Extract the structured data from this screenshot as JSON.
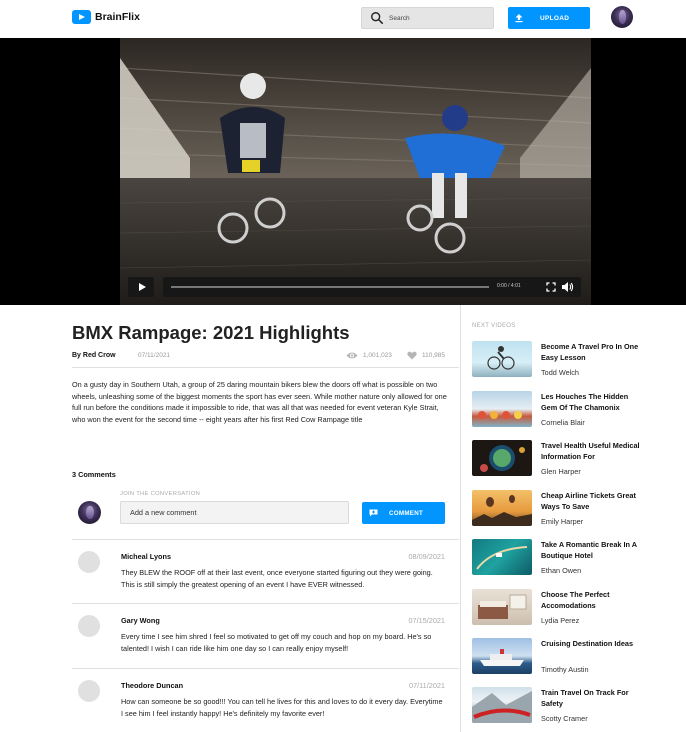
{
  "header": {
    "logo_text": "BrainFlix",
    "search_placeholder": "Search",
    "upload_label": "UPLOAD"
  },
  "player": {
    "time": "0:00 / 4:01",
    "progress": 0
  },
  "video": {
    "title": "BMX Rampage: 2021 Highlights",
    "channel": "By Red Crow",
    "date": "07/11/2021",
    "views": "1,001,023",
    "likes": "110,985",
    "description": "On a gusty day in Southern Utah, a group of 25 daring mountain bikers blew the doors off what is possible on two wheels, unleashing some of the biggest moments the sport has ever seen. While mother nature only allowed for one full run before the conditions made it impossible to ride, that was all that was needed for event veteran Kyle Strait, who won the event for the second time -- eight years after his first Red Cow Rampage title"
  },
  "comments_section": {
    "count_label": "3 Comments",
    "join_label": "JOIN THE CONVERSATION",
    "input_placeholder": "Add a new comment",
    "button_label": "COMMENT",
    "comments": [
      {
        "name": "Micheal Lyons",
        "date": "08/09/2021",
        "text": "They BLEW the ROOF off at their last event, once everyone started figuring out they were going. This is still simply the greatest opening of an event I have EVER witnessed."
      },
      {
        "name": "Gary Wong",
        "date": "07/15/2021",
        "text": "Every time I see him shred I feel so motivated to get off my couch and hop on my board. He's so talented! I wish I can ride like him one day so I can really enjoy myself!"
      },
      {
        "name": "Theodore Duncan",
        "date": "07/11/2021",
        "text": "How can someone be so good!!! You can tell he lives for this and loves to do it every day. Everytime I see him I feel instantly happy! He's definitely my favorite ever!"
      }
    ]
  },
  "next_videos": {
    "label": "NEXT VIDEOS",
    "items": [
      {
        "title": "Become A Travel Pro In One Easy Lesson",
        "author": "Todd Welch"
      },
      {
        "title": "Les Houches The Hidden Gem Of The Chamonix",
        "author": "Cornelia Blair"
      },
      {
        "title": "Travel Health Useful Medical Information For",
        "author": "Glen Harper"
      },
      {
        "title": "Cheap Airline Tickets Great Ways To Save",
        "author": "Emily Harper"
      },
      {
        "title": "Take A Romantic Break In A Boutique Hotel",
        "author": "Ethan Owen"
      },
      {
        "title": "Choose The Perfect Accomodations",
        "author": "Lydia Perez"
      },
      {
        "title": "Cruising Destination Ideas",
        "author": "Timothy Austin"
      },
      {
        "title": "Train Travel On Track For Safety",
        "author": "Scotty Cramer"
      }
    ]
  },
  "colors": {
    "accent": "#0095ff"
  }
}
